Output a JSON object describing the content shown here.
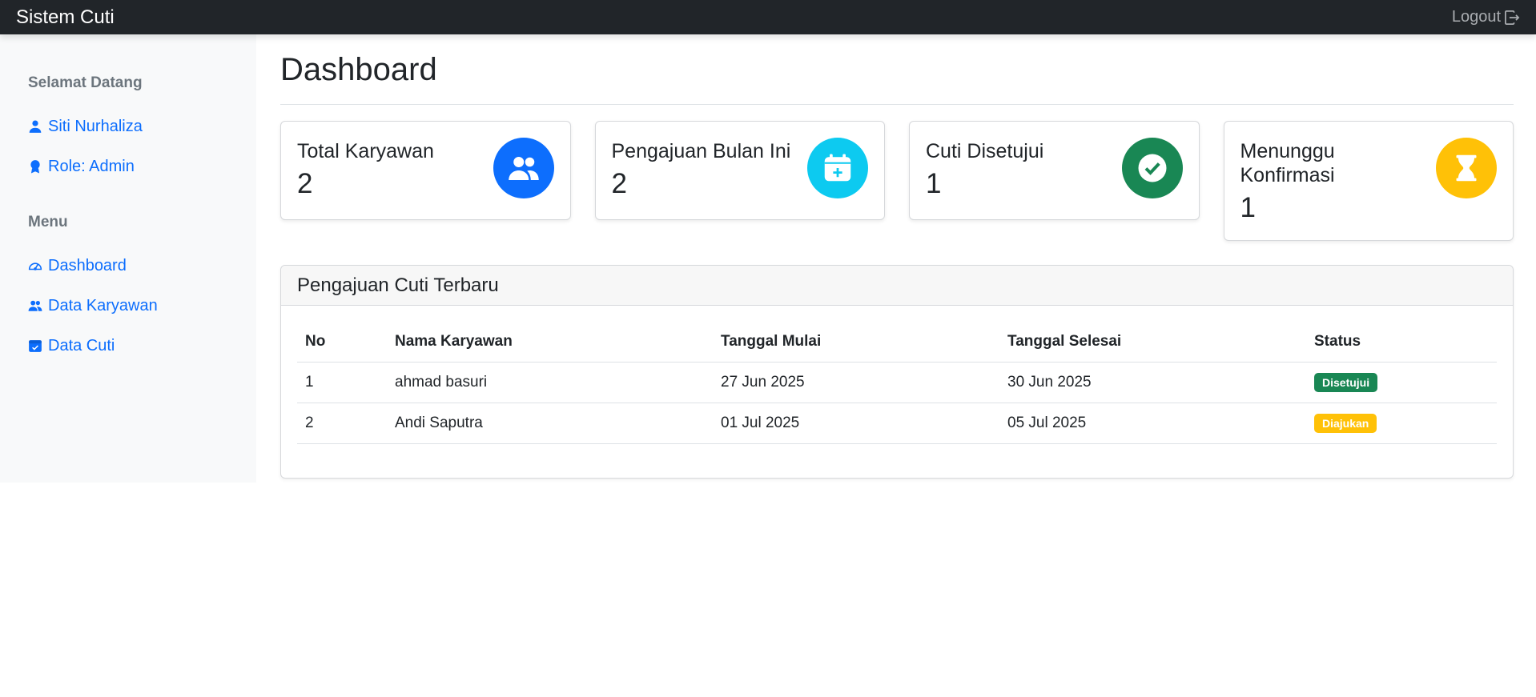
{
  "navbar": {
    "brand": "Sistem Cuti",
    "logout_label": "Logout"
  },
  "sidebar": {
    "welcome_heading": "Selamat Datang",
    "user_name": "Siti Nurhaliza",
    "role": "Role: Admin",
    "menu_heading": "Menu",
    "items": [
      {
        "label": "Dashboard",
        "icon": "speedometer-icon"
      },
      {
        "label": "Data Karyawan",
        "icon": "people-icon"
      },
      {
        "label": "Data Cuti",
        "icon": "calendar-check-icon"
      }
    ]
  },
  "main": {
    "title": "Dashboard",
    "cards": [
      {
        "title": "Total Karyawan",
        "value": "2",
        "icon": "people-icon",
        "color": "#0d6efd"
      },
      {
        "title": "Pengajuan Bulan Ini",
        "value": "2",
        "icon": "calendar-plus-icon",
        "color": "#0dcaf0"
      },
      {
        "title": "Cuti Disetujui",
        "value": "1",
        "icon": "check-circle-icon",
        "color": "#198754"
      },
      {
        "title": "Menunggu Konfirmasi",
        "value": "1",
        "icon": "hourglass-icon",
        "color": "#ffc107"
      }
    ],
    "recent": {
      "title": "Pengajuan Cuti Terbaru",
      "columns": [
        "No",
        "Nama Karyawan",
        "Tanggal Mulai",
        "Tanggal Selesai",
        "Status"
      ],
      "rows": [
        {
          "no": "1",
          "name": "ahmad basuri",
          "start": "27 Jun 2025",
          "end": "30 Jun 2025",
          "status": "Disetujui",
          "status_color": "#198754"
        },
        {
          "no": "2",
          "name": "Andi Saputra",
          "start": "01 Jul 2025",
          "end": "05 Jul 2025",
          "status": "Diajukan",
          "status_color": "#ffc107"
        }
      ]
    }
  }
}
